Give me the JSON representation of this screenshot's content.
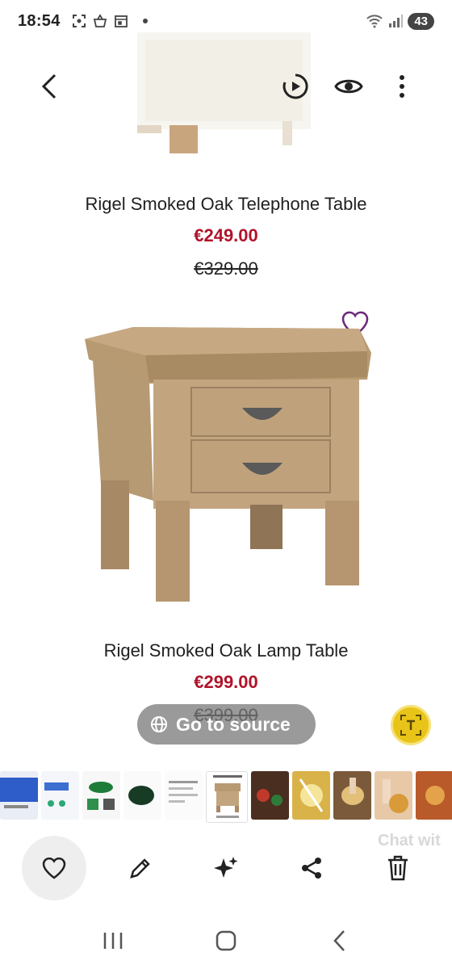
{
  "status_bar": {
    "time": "18:54",
    "battery": "43"
  },
  "products": [
    {
      "name": "Rigel Smoked Oak Telephone Table",
      "price": "€249.00",
      "old_price": "€329.00"
    },
    {
      "name": "Rigel Smoked Oak Lamp Table",
      "price": "€299.00",
      "old_price": "€399.00"
    }
  ],
  "overlay": {
    "go_to_source": "Go to source",
    "ghost_chat": "Chat wit"
  },
  "colors": {
    "price": "#b0142b",
    "wishlist": "#6b2a7a",
    "text_scan": "#e9c418"
  },
  "icons": {
    "back": "back-arrow-icon",
    "motion": "motion-photo-icon",
    "view": "eye-icon",
    "more": "more-vertical-icon",
    "globe": "globe-icon",
    "favorite": "heart-icon",
    "edit": "pencil-icon",
    "ai": "sparkle-icon",
    "share": "share-icon",
    "delete": "trash-icon"
  }
}
